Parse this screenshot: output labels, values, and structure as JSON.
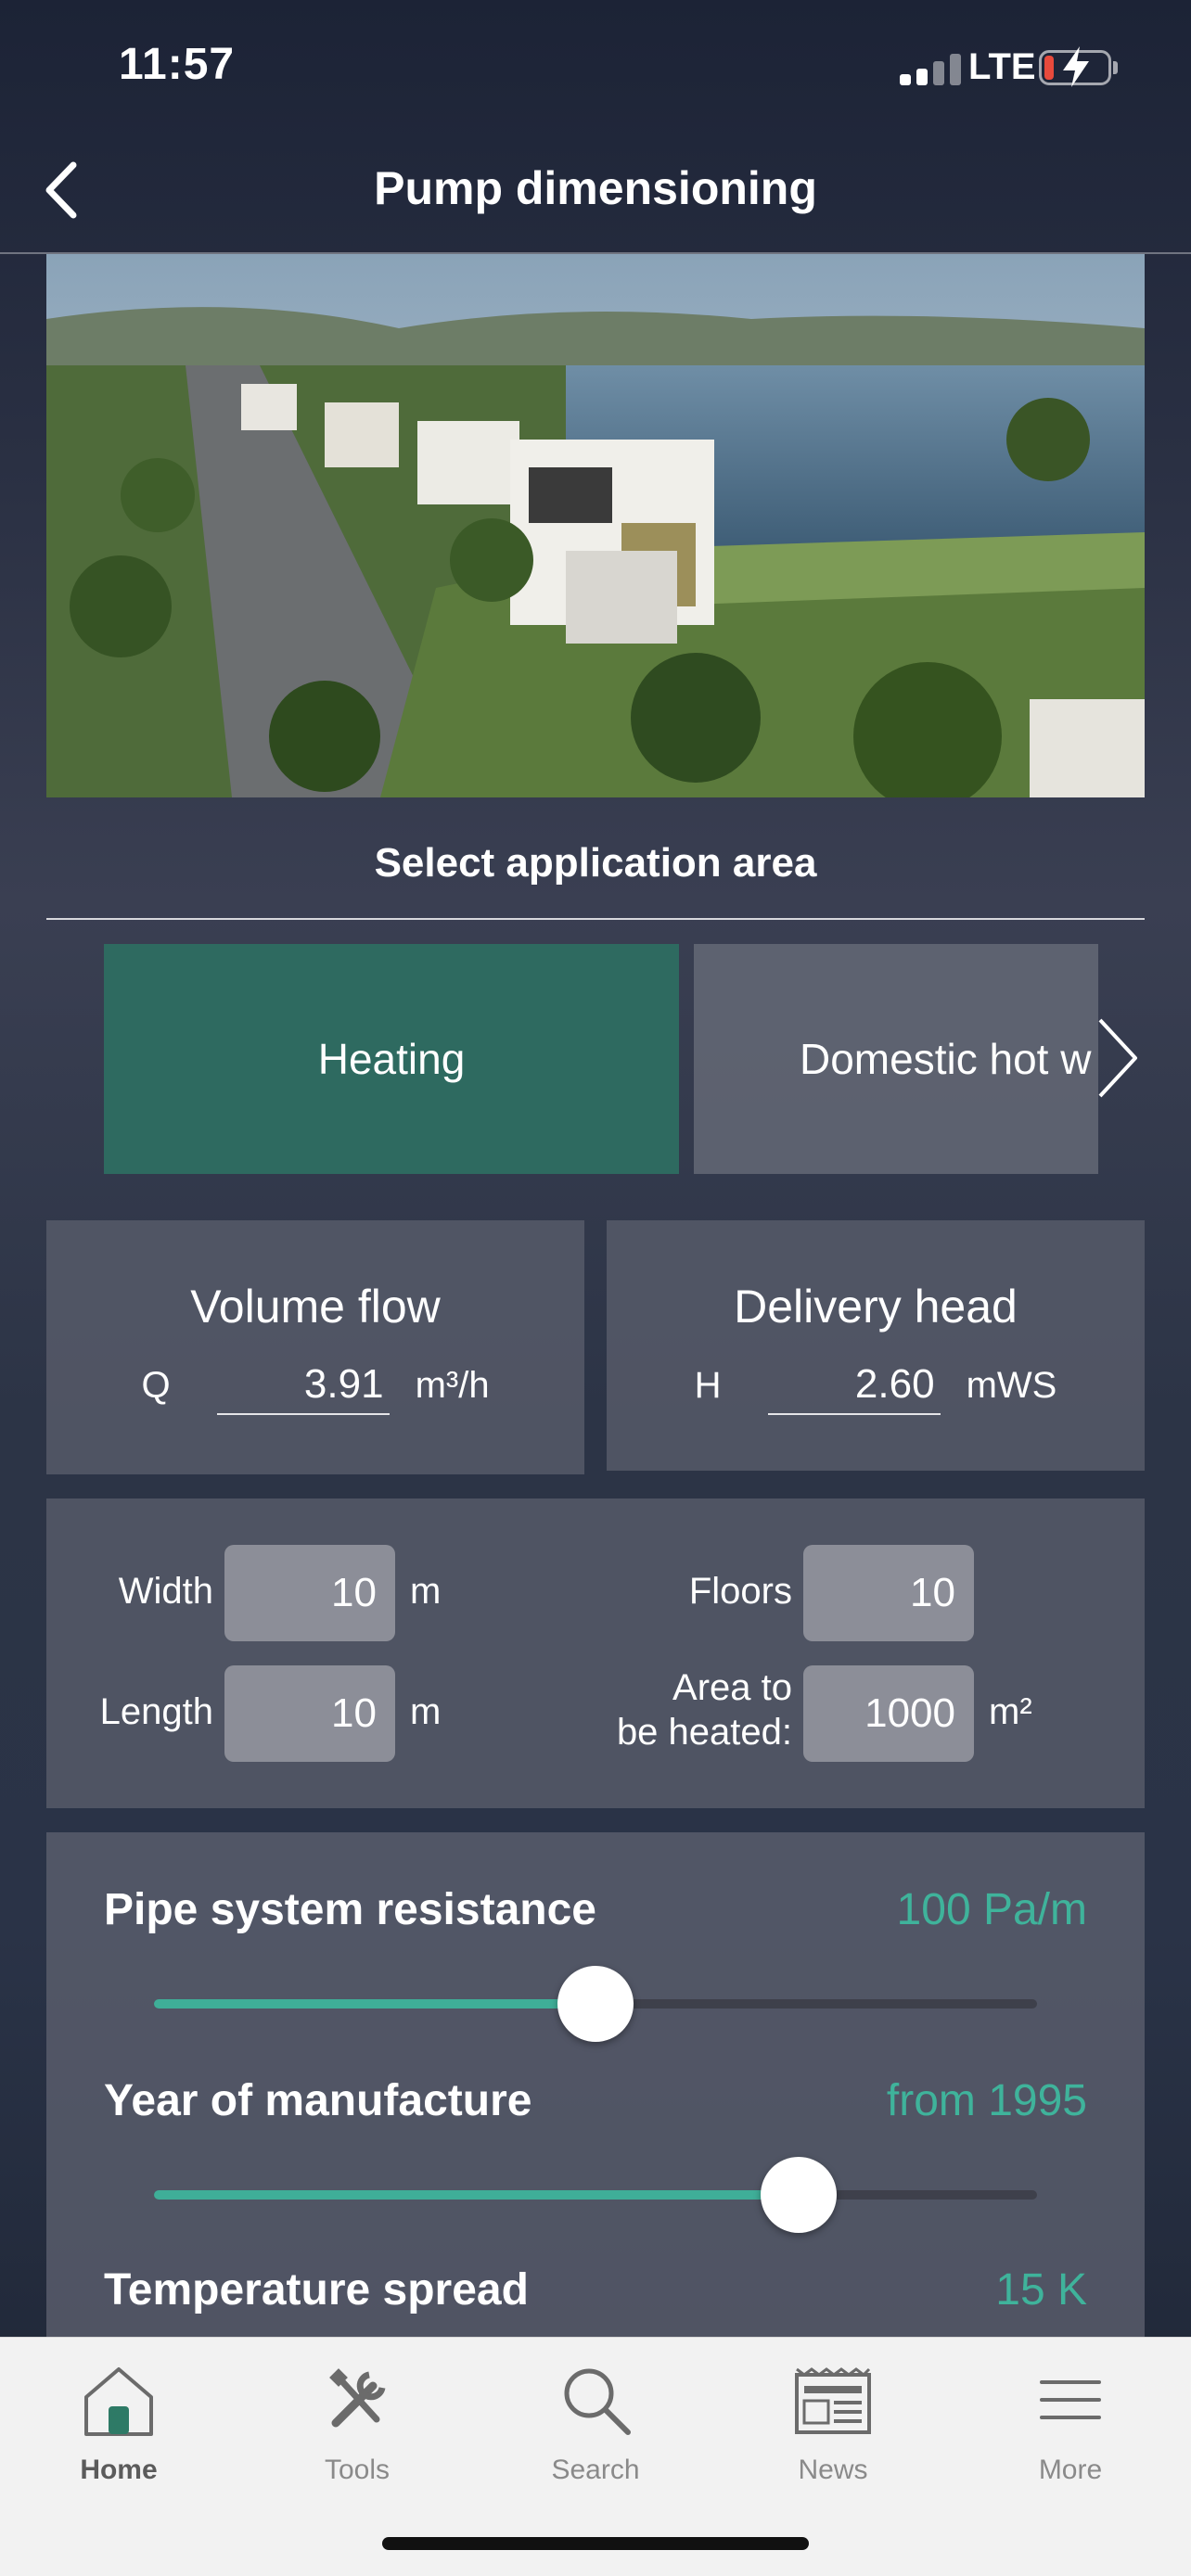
{
  "status_bar": {
    "time": "11:57",
    "network": "LTE",
    "signal_bars": 2,
    "battery_charging": true
  },
  "nav": {
    "title": "Pump dimensioning",
    "back_icon": "chevron-left-icon"
  },
  "section": {
    "title": "Select application area"
  },
  "application_tabs": [
    {
      "label": "Heating",
      "selected": true
    },
    {
      "label": "Domestic hot w",
      "selected": false
    }
  ],
  "volume_flow": {
    "title": "Volume flow",
    "symbol": "Q",
    "value": "3.91",
    "unit": "m³/h"
  },
  "delivery_head": {
    "title": "Delivery head",
    "symbol": "H",
    "value": "2.60",
    "unit": "mWS"
  },
  "dimensions": {
    "width": {
      "label": "Width",
      "value": "10",
      "unit": "m"
    },
    "length": {
      "label": "Length",
      "value": "10",
      "unit": "m"
    },
    "floors": {
      "label": "Floors",
      "value": "10"
    },
    "area": {
      "label_line1": "Area to",
      "label_line2": "be heated:",
      "value": "1000",
      "unit": "m²"
    }
  },
  "sliders": [
    {
      "label": "Pipe system resistance",
      "value": "100 Pa/m",
      "level": 0.5
    },
    {
      "label": "Year of manufacture",
      "value": "from 1995",
      "level": 0.73
    },
    {
      "label": "Temperature spread",
      "value": "15 K"
    }
  ],
  "tab_bar": [
    {
      "label": "Home",
      "icon": "home-icon",
      "active": true
    },
    {
      "label": "Tools",
      "icon": "tools-icon",
      "active": false
    },
    {
      "label": "Search",
      "icon": "search-icon",
      "active": false
    },
    {
      "label": "News",
      "icon": "news-icon",
      "active": false
    },
    {
      "label": "More",
      "icon": "menu-icon",
      "active": false
    }
  ],
  "colors": {
    "accent": "#3fb39b",
    "selected_tab": "#2e6a60"
  }
}
